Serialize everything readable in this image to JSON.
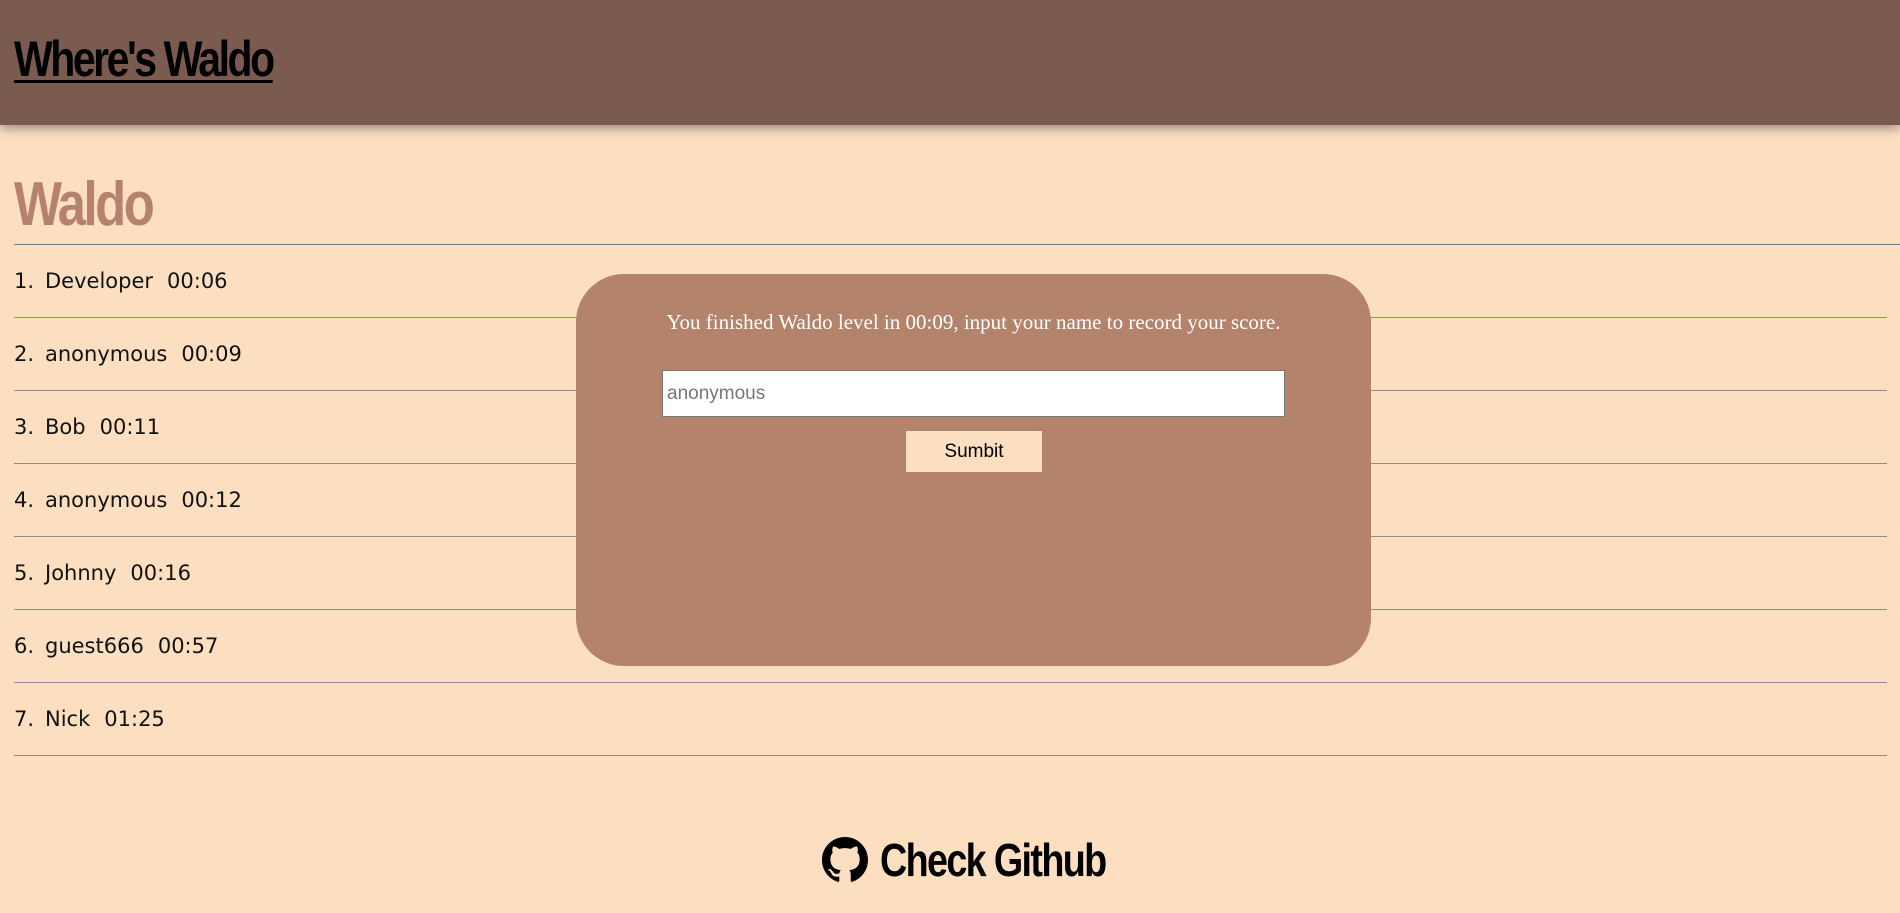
{
  "header": {
    "title": "Where's Waldo"
  },
  "page": {
    "title": "Waldo"
  },
  "leaderboard": [
    {
      "rank": "1.",
      "name": "Developer",
      "time": "00:06"
    },
    {
      "rank": "2.",
      "name": "anonymous",
      "time": "00:09"
    },
    {
      "rank": "3.",
      "name": "Bob",
      "time": "00:11"
    },
    {
      "rank": "4.",
      "name": "anonymous",
      "time": "00:12"
    },
    {
      "rank": "5.",
      "name": "Johnny",
      "time": "00:16"
    },
    {
      "rank": "6.",
      "name": "guest666",
      "time": "00:57"
    },
    {
      "rank": "7.",
      "name": "Nick",
      "time": "01:25"
    }
  ],
  "modal": {
    "message": "You finished Waldo level in 00:09, input your name to record your score.",
    "input_placeholder": "anonymous",
    "input_value": "",
    "submit_label": "Sumbit"
  },
  "footer": {
    "link_label": "Check Github",
    "icon": "github-icon"
  },
  "colors": {
    "header_bg": "#7b5b50",
    "page_bg": "#fcdfc1",
    "accent": "#b5836d",
    "modal_bg": "#b3836c"
  }
}
